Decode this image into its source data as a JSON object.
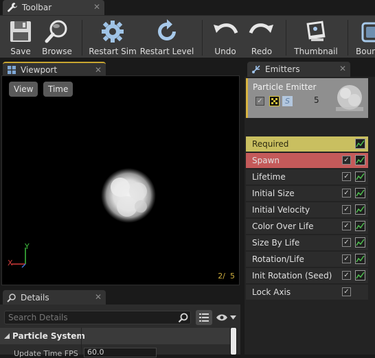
{
  "toolbar_tab": {
    "label": "Toolbar",
    "close": "✕"
  },
  "toolbar": {
    "buttons": [
      {
        "label": "Save"
      },
      {
        "label": "Browse"
      },
      {
        "label": "Restart Sim"
      },
      {
        "label": "Restart Level"
      },
      {
        "label": "Undo"
      },
      {
        "label": "Redo"
      },
      {
        "label": "Thumbnail"
      },
      {
        "label": "Boun"
      }
    ]
  },
  "viewport_tab": {
    "label": "Viewport",
    "close": "✕"
  },
  "viewport": {
    "view_button": "View",
    "time_button": "Time",
    "axis_x": "X",
    "axis_y": "Y",
    "counter": "2/  5"
  },
  "emitters_tab": {
    "label": "Emitters",
    "close": "✕"
  },
  "emitter": {
    "name": "Particle Emitter",
    "letter_badge": "S",
    "count": "5",
    "modules": [
      {
        "label": "Required",
        "color": "#cfc466"
      },
      {
        "label": "Spawn",
        "color": "#c75c5c"
      },
      {
        "label": "Lifetime"
      },
      {
        "label": "Initial Size"
      },
      {
        "label": "Initial Velocity"
      },
      {
        "label": "Color Over Life"
      },
      {
        "label": "Size By Life"
      },
      {
        "label": "Rotation/Life"
      },
      {
        "label": "Init Rotation (Seed)"
      },
      {
        "label": "Lock Axis"
      }
    ]
  },
  "details_tab": {
    "label": "Details",
    "close": "✕"
  },
  "details": {
    "search_placeholder": "Search Details",
    "section_title": "Particle System",
    "row_label": "Update Time FPS",
    "row_value": "60.0"
  }
}
